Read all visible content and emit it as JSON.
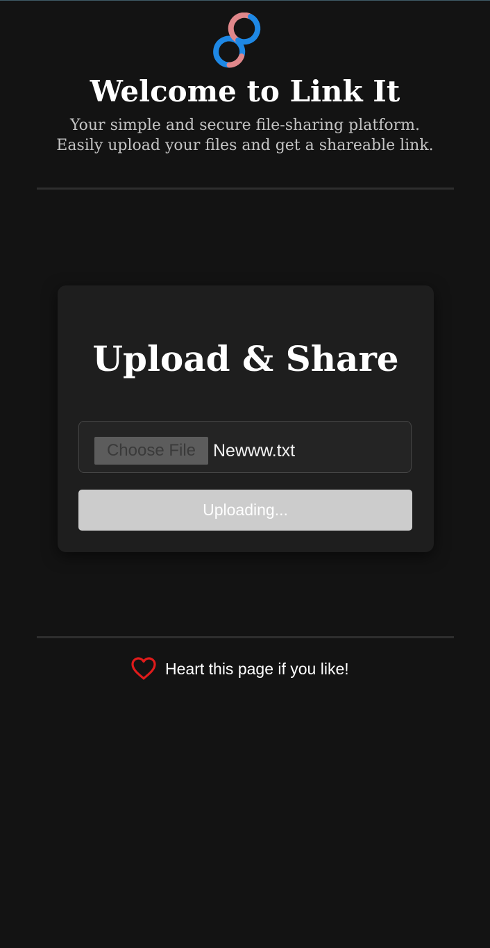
{
  "header": {
    "logo_icon": "link-infinity-icon",
    "title": "Welcome to Link It",
    "subtitle_line1": "Your simple and secure file-sharing platform.",
    "subtitle_line2": "Easily upload your files and get a shareable link."
  },
  "upload_card": {
    "title": "Upload & Share",
    "choose_file_label": "Choose File",
    "selected_file": "Newww.txt",
    "upload_button_label": "Uploading..."
  },
  "footer": {
    "heart_icon": "heart-icon",
    "text": "Heart this page if you like!"
  },
  "colors": {
    "background": "#131313",
    "card": "#1e1e1e",
    "logo_blue": "#1e88e5",
    "logo_pink": "#e0878a",
    "heart_red": "#e01b1b",
    "button_disabled": "#cccccc"
  }
}
